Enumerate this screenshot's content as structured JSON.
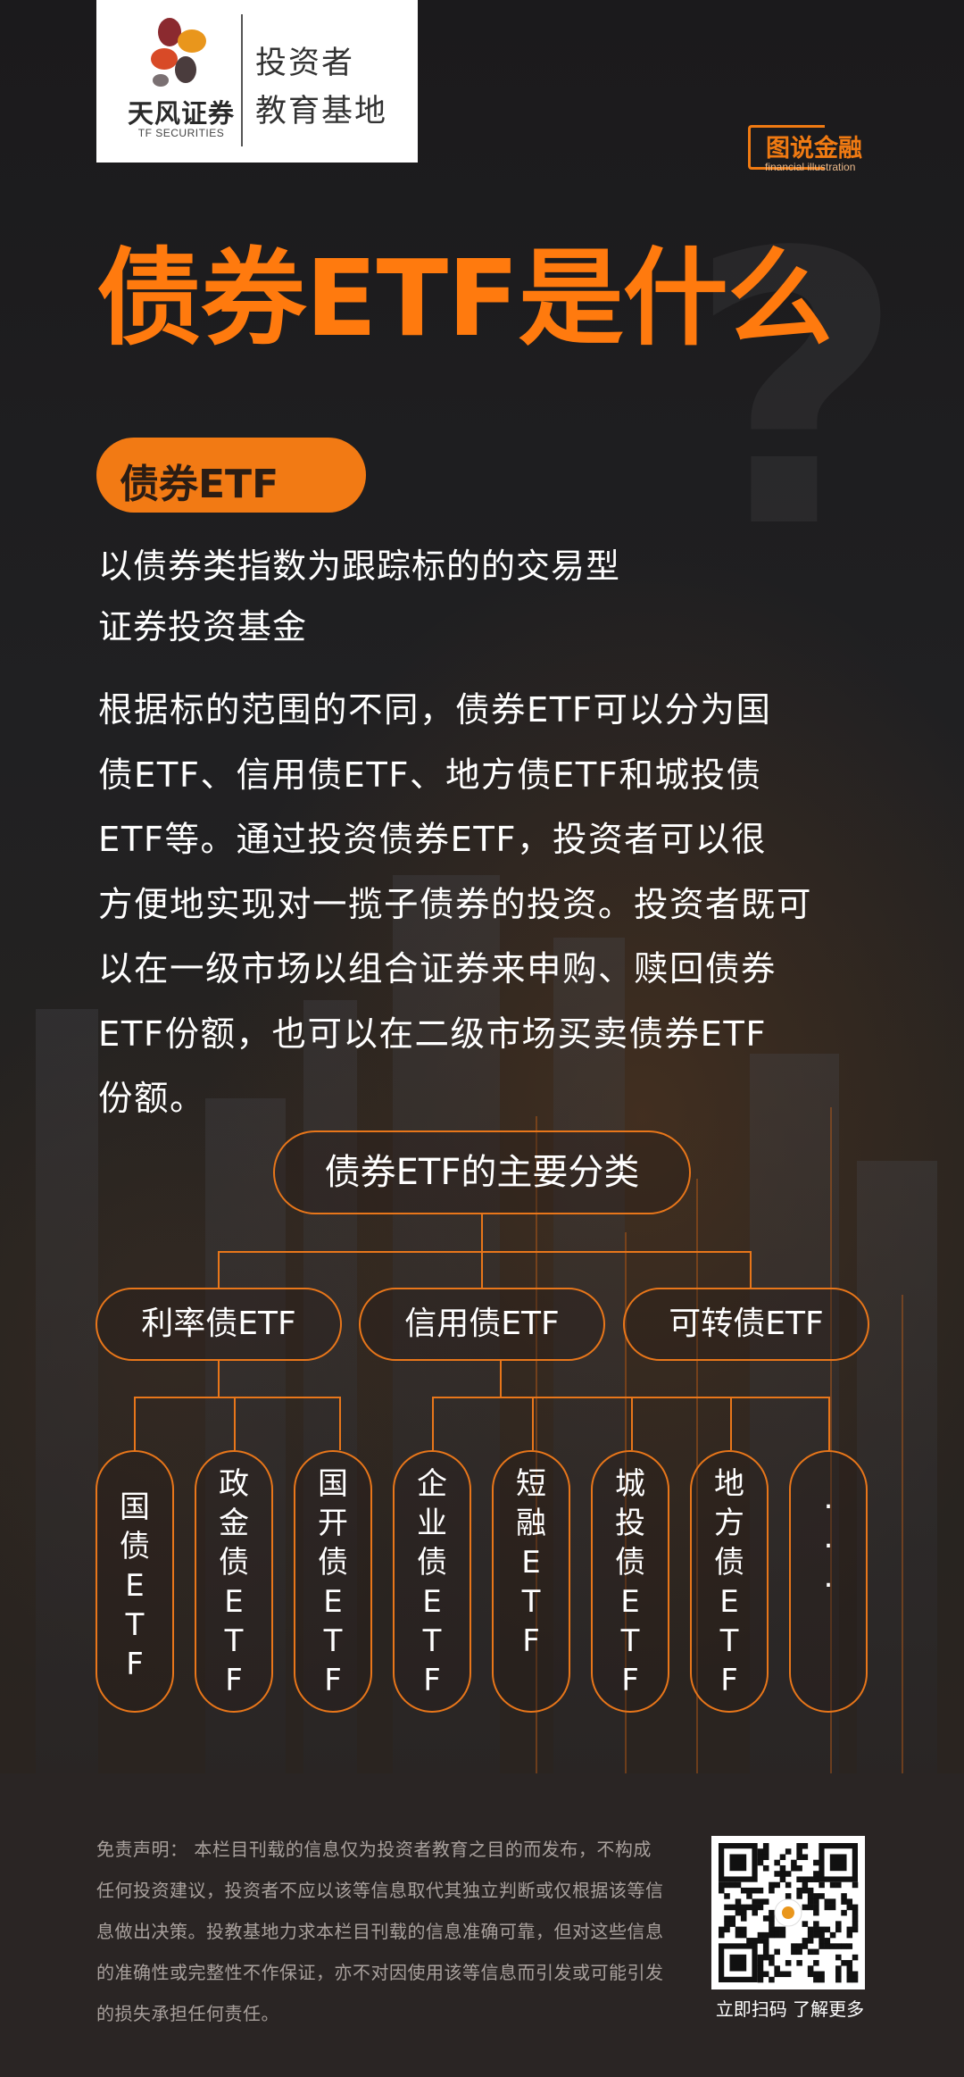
{
  "logo": {
    "name_cn": "天风证券",
    "name_en": "TF SECURITIES",
    "line1": "投资者",
    "line2": "教育基地"
  },
  "badge": {
    "title": "图说金融",
    "subtitle": "financial illustration"
  },
  "title": "债券ETF是什么",
  "pill_label": "债券ETF",
  "definition_lines": [
    "以债券类指数为跟踪标的的交易型",
    "证券投资基金"
  ],
  "body_lines": [
    "根据标的范围的不同，债券ETF可以分为国",
    "债ETF、信用债ETF、地方债ETF和城投债",
    "ETF等。通过投资债券ETF，投资者可以很",
    "方便地实现对一揽子债券的投资。投资者既可",
    "以在一级市场以组合证券来申购、赎回债券",
    "ETF份额，也可以在二级市场买卖债券ETF",
    "份额。"
  ],
  "diagram": {
    "root": "债券ETF的主要分类",
    "categories": [
      "利率债ETF",
      "信用债ETF",
      "可转债ETF"
    ],
    "leaves": [
      "国\n债\nE\nT\nF",
      "政\n金\n债\nE\nT\nF",
      "国\n开\n债\nE\nT\nF",
      "企\n业\n债\nE\nT\nF",
      "短\n融\nE\nT\nF",
      "城\n投\n债\nE\nT\nF",
      "地\n方\n债\nE\nT\nF",
      ".\n.\n."
    ]
  },
  "footer": {
    "disclaimer_lines": [
      "免责声明： 本栏目刊载的信息仅为投资者教育之目的而发布，不构成",
      "任何投资建议，投资者不应以该等信息取代其独立判断或仅根据该等信",
      "息做出决策。投教基地力求本栏目刊载的信息准确可靠，但对这些信息",
      "的准确性或完整性不作保证，亦不对因使用该等信息而引发或可能引发",
      "的损失承担任何责任。"
    ],
    "qr_caption": "立即扫码 了解更多"
  },
  "colors": {
    "accent": "#f27a14",
    "background": "#1c1a1b",
    "footer_bg": "#2a2524"
  }
}
